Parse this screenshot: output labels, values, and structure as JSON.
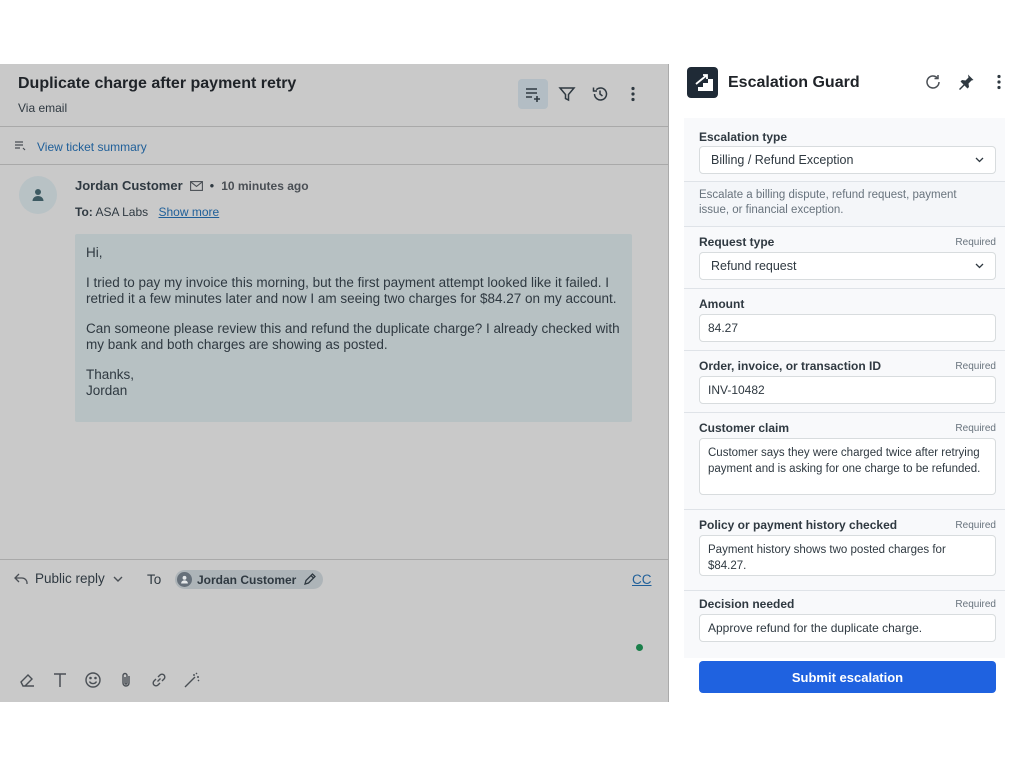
{
  "ticket": {
    "title": "Duplicate charge after payment retry",
    "channel": "Via email",
    "summary_link": "View ticket summary"
  },
  "message": {
    "sender": "Jordan Customer",
    "separator": "•",
    "time": "10 minutes ago",
    "to_label": "To:",
    "to_value": "ASA Labs",
    "show_more": "Show more",
    "greeting": "Hi,",
    "paragraph_1": "I tried to pay my invoice this morning, but the first payment attempt looked like it failed. I retried it a few minutes later and now I am seeing two charges for $84.27 on my account.",
    "paragraph_2": "Can someone please review this and refund the duplicate charge? I already checked with my bank and both charges are showing as posted.",
    "signoff": "Thanks,",
    "signature": "Jordan"
  },
  "composer": {
    "reply_mode": "Public reply",
    "to_label": "To",
    "recipient": "Jordan Customer",
    "cc": "CC"
  },
  "panel": {
    "title": "Escalation Guard",
    "submit_label": "Submit escalation",
    "required_label": "Required",
    "fields": {
      "escalation_type_label": "Escalation type",
      "escalation_type_value": "Billing / Refund Exception",
      "description": "Escalate a billing dispute, refund request, payment issue, or financial exception.",
      "request_type_label": "Request type",
      "request_type_value": "Refund request",
      "amount_label": "Amount",
      "amount_value": "84.27",
      "order_id_label": "Order, invoice, or transaction ID",
      "order_id_value": "INV-10482",
      "customer_claim_label": "Customer claim",
      "customer_claim_value": "Customer says they were charged twice after retrying payment and is asking for one charge to be refunded.",
      "policy_label": "Policy or payment history checked",
      "policy_value": "Payment history shows two posted charges for $84.27.",
      "decision_label": "Decision needed",
      "decision_value": "Approve refund for the duplicate charge."
    }
  },
  "colors": {
    "accent": "#1f62e0",
    "link": "#1f5f99",
    "online": "#1a7f4a"
  }
}
